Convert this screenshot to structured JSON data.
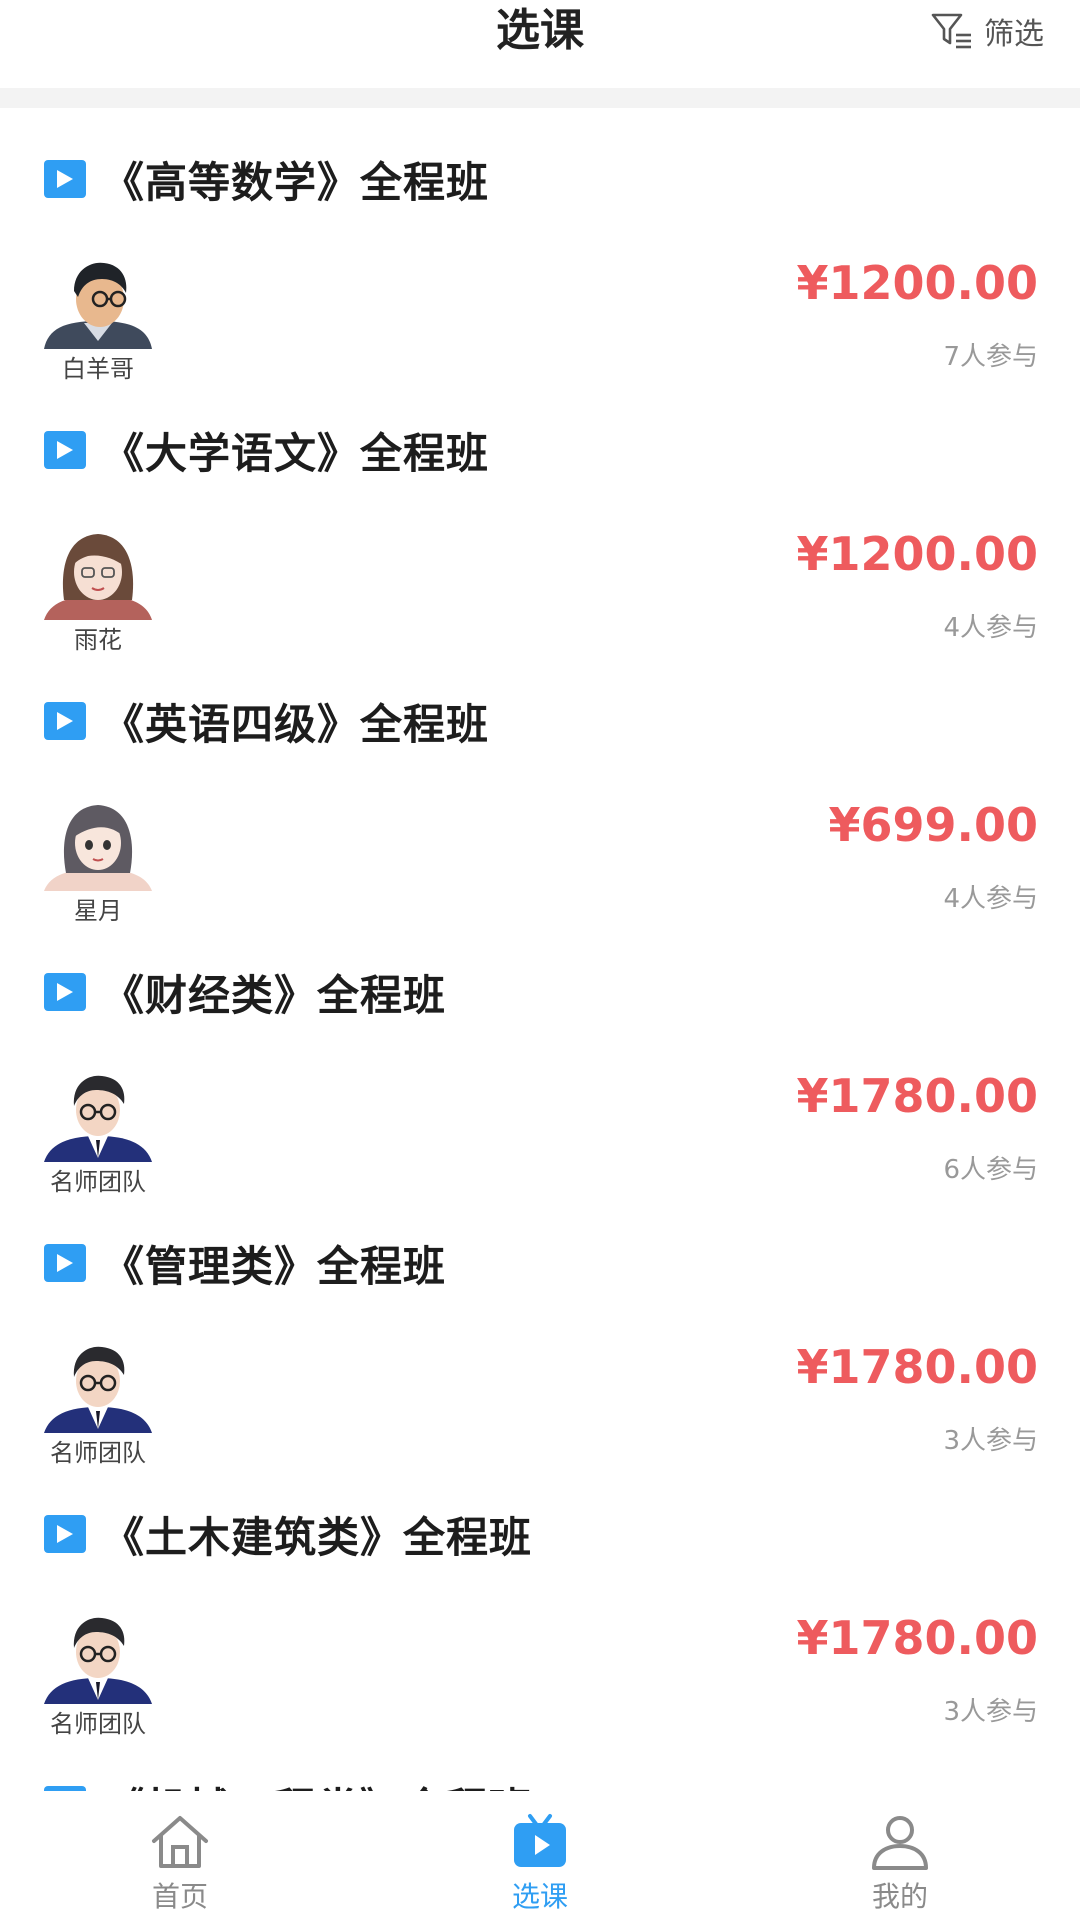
{
  "header": {
    "title": "选课",
    "filter_label": "筛选"
  },
  "courses": [
    {
      "title": "《高等数学》全程班",
      "teacher": "白羊哥",
      "price": "¥1200.00",
      "participants": "7人参与",
      "avatar": "man-glasses-gray"
    },
    {
      "title": "《大学语文》全程班",
      "teacher": "雨花",
      "price": "¥1200.00",
      "participants": "4人参与",
      "avatar": "woman-brown-hair"
    },
    {
      "title": "《英语四级》全程班",
      "teacher": "星月",
      "price": "¥699.00",
      "participants": "4人参与",
      "avatar": "woman-gray-hair"
    },
    {
      "title": "《财经类》全程班",
      "teacher": "名师团队",
      "price": "¥1780.00",
      "participants": "6人参与",
      "avatar": "man-glasses-suit"
    },
    {
      "title": "《管理类》全程班",
      "teacher": "名师团队",
      "price": "¥1780.00",
      "participants": "3人参与",
      "avatar": "man-glasses-suit"
    },
    {
      "title": "《土木建筑类》全程班",
      "teacher": "名师团队",
      "price": "¥1780.00",
      "participants": "3人参与",
      "avatar": "man-glasses-suit"
    },
    {
      "title": "《机械工程类》全程班",
      "teacher": "",
      "price": "",
      "participants": "",
      "avatar": ""
    }
  ],
  "tabbar": {
    "tabs": [
      {
        "label": "首页",
        "icon": "home-icon",
        "active": false
      },
      {
        "label": "选课",
        "icon": "tv-play-icon",
        "active": true
      },
      {
        "label": "我的",
        "icon": "user-icon",
        "active": false
      }
    ]
  },
  "colors": {
    "accent": "#2f9ef3",
    "price": "#ee5b5e",
    "muted": "#999999"
  }
}
